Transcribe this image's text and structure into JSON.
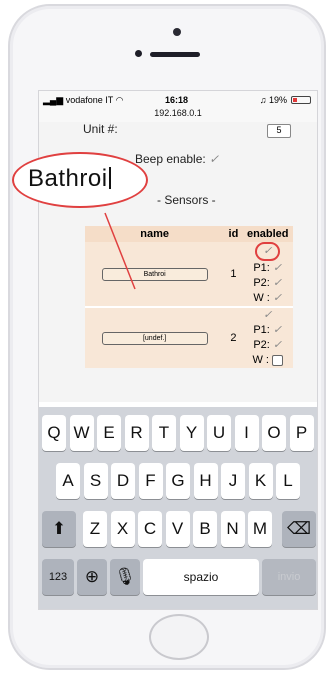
{
  "status_bar": {
    "carrier": "vodafone IT",
    "time": "16:18",
    "battery": "19%",
    "url": "192.168.0.1"
  },
  "page": {
    "unit_label": "Unit #:",
    "unit_value": "5",
    "beep_label": "Beep enable:",
    "check_mark": "✓",
    "sensors_heading": "- Sensors -",
    "table_headers": {
      "name": "name",
      "id": "id",
      "enabled": "enabled"
    },
    "rows": [
      {
        "name": "Bathroi",
        "id": "1",
        "p1": "P1:",
        "p2": "P2:",
        "w": "W :"
      },
      {
        "name": "[undef.]",
        "id": "2",
        "p1": "P1:",
        "p2": "P2:",
        "w": "W :"
      }
    ]
  },
  "callout": {
    "text": "Bathroi"
  },
  "keyboard": {
    "row1": [
      "Q",
      "W",
      "E",
      "R",
      "T",
      "Y",
      "U",
      "I",
      "O",
      "P"
    ],
    "row2": [
      "A",
      "S",
      "D",
      "F",
      "G",
      "H",
      "J",
      "K",
      "L"
    ],
    "row3": [
      "Z",
      "X",
      "C",
      "V",
      "B",
      "N",
      "M"
    ],
    "shift": "⬆",
    "backspace": "⌫",
    "numbers": "123",
    "globe": "⊕",
    "mic": "🎙",
    "space": "spazio",
    "enter": "invio"
  }
}
